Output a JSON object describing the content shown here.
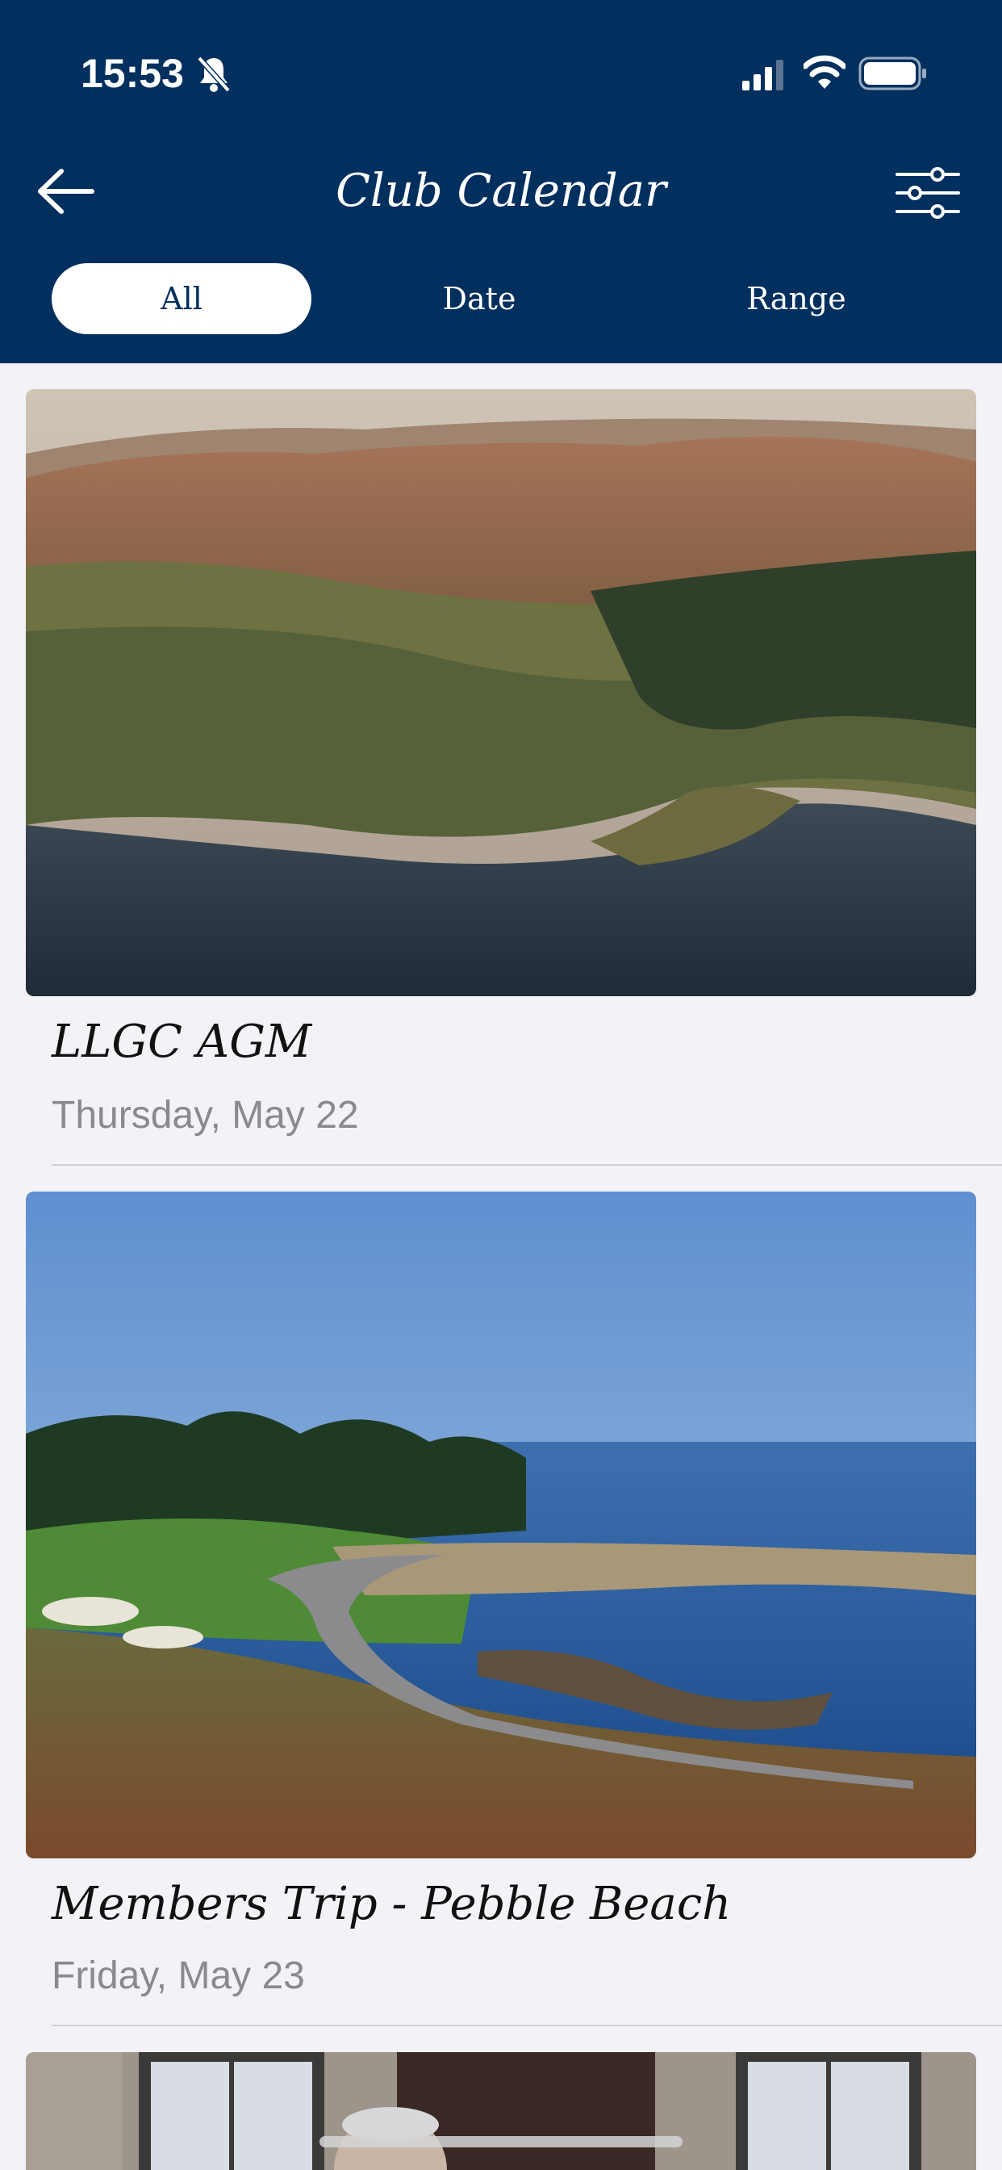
{
  "status_bar": {
    "time": "15:53"
  },
  "header": {
    "title": "Club Calendar"
  },
  "segments": {
    "all": "All",
    "date": "Date",
    "range": "Range"
  },
  "events": [
    {
      "title": "LLGC AGM",
      "date": "Thursday, May 22"
    },
    {
      "title": "Members Trip - Pebble Beach",
      "date": "Friday, May 23"
    }
  ],
  "colors": {
    "header_bg": "#012f5e",
    "page_bg": "#f2f2f7",
    "date_text": "#8a8a8e"
  }
}
